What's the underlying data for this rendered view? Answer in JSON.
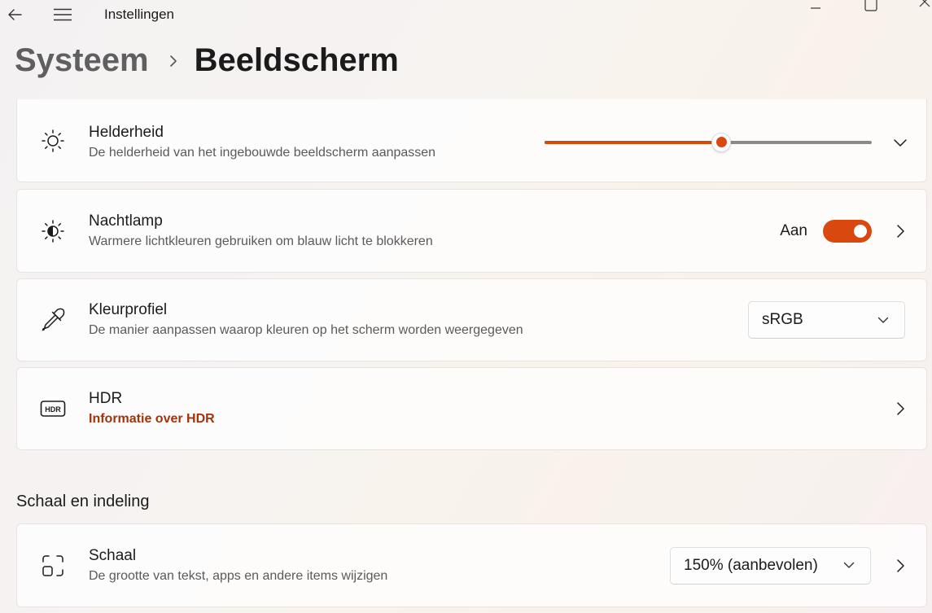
{
  "app": {
    "title": "Instellingen"
  },
  "breadcrumb": {
    "parent": "Systeem",
    "current": "Beeldscherm"
  },
  "brightness": {
    "title": "Helderheid",
    "subtitle": "De helderheid van het ingebouwde beeldscherm aanpassen",
    "value_fraction": 0.54
  },
  "nightlight": {
    "title": "Nachtlamp",
    "subtitle": "Warmere lichtkleuren gebruiken om blauw licht te blokkeren",
    "state_label": "Aan",
    "enabled": true
  },
  "color_profile": {
    "title": "Kleurprofiel",
    "subtitle": "De manier aanpassen waarop kleuren op het scherm worden weergegeven",
    "selected": "sRGB"
  },
  "hdr": {
    "title": "HDR",
    "link": "Informatie over HDR",
    "icon_text": "HDR"
  },
  "scale_section": {
    "header": "Schaal en indeling",
    "scale": {
      "title": "Schaal",
      "subtitle": "De grootte van tekst, apps en andere items wijzigen",
      "selected": "150% (aanbevolen)"
    }
  },
  "colors": {
    "accent": "#d9480f",
    "link": "#a3330a"
  }
}
